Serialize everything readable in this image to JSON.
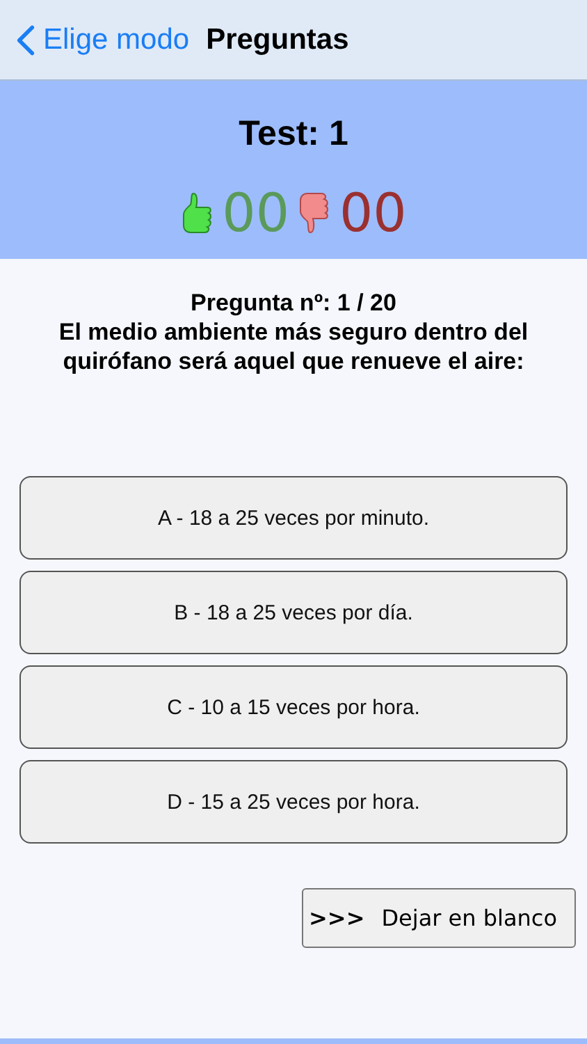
{
  "nav": {
    "back": "Elige modo",
    "title": "Preguntas"
  },
  "header": {
    "test": "Test: 1",
    "correct": "00",
    "wrong": "00"
  },
  "question": {
    "number": "Pregunta nº: 1 / 20",
    "text": "El medio ambiente más seguro dentro del quirófano será aquel que renueve el aire:"
  },
  "answers": [
    {
      "label": "A - 18 a 25 veces por minuto."
    },
    {
      "label": "B - 18 a 25 veces por día."
    },
    {
      "label": "C - 10 a 15 veces por hora."
    },
    {
      "label": "D - 15 a 25 veces por hora."
    }
  ],
  "skip": {
    "arrows": ">>>",
    "label": "Dejar en blanco"
  }
}
